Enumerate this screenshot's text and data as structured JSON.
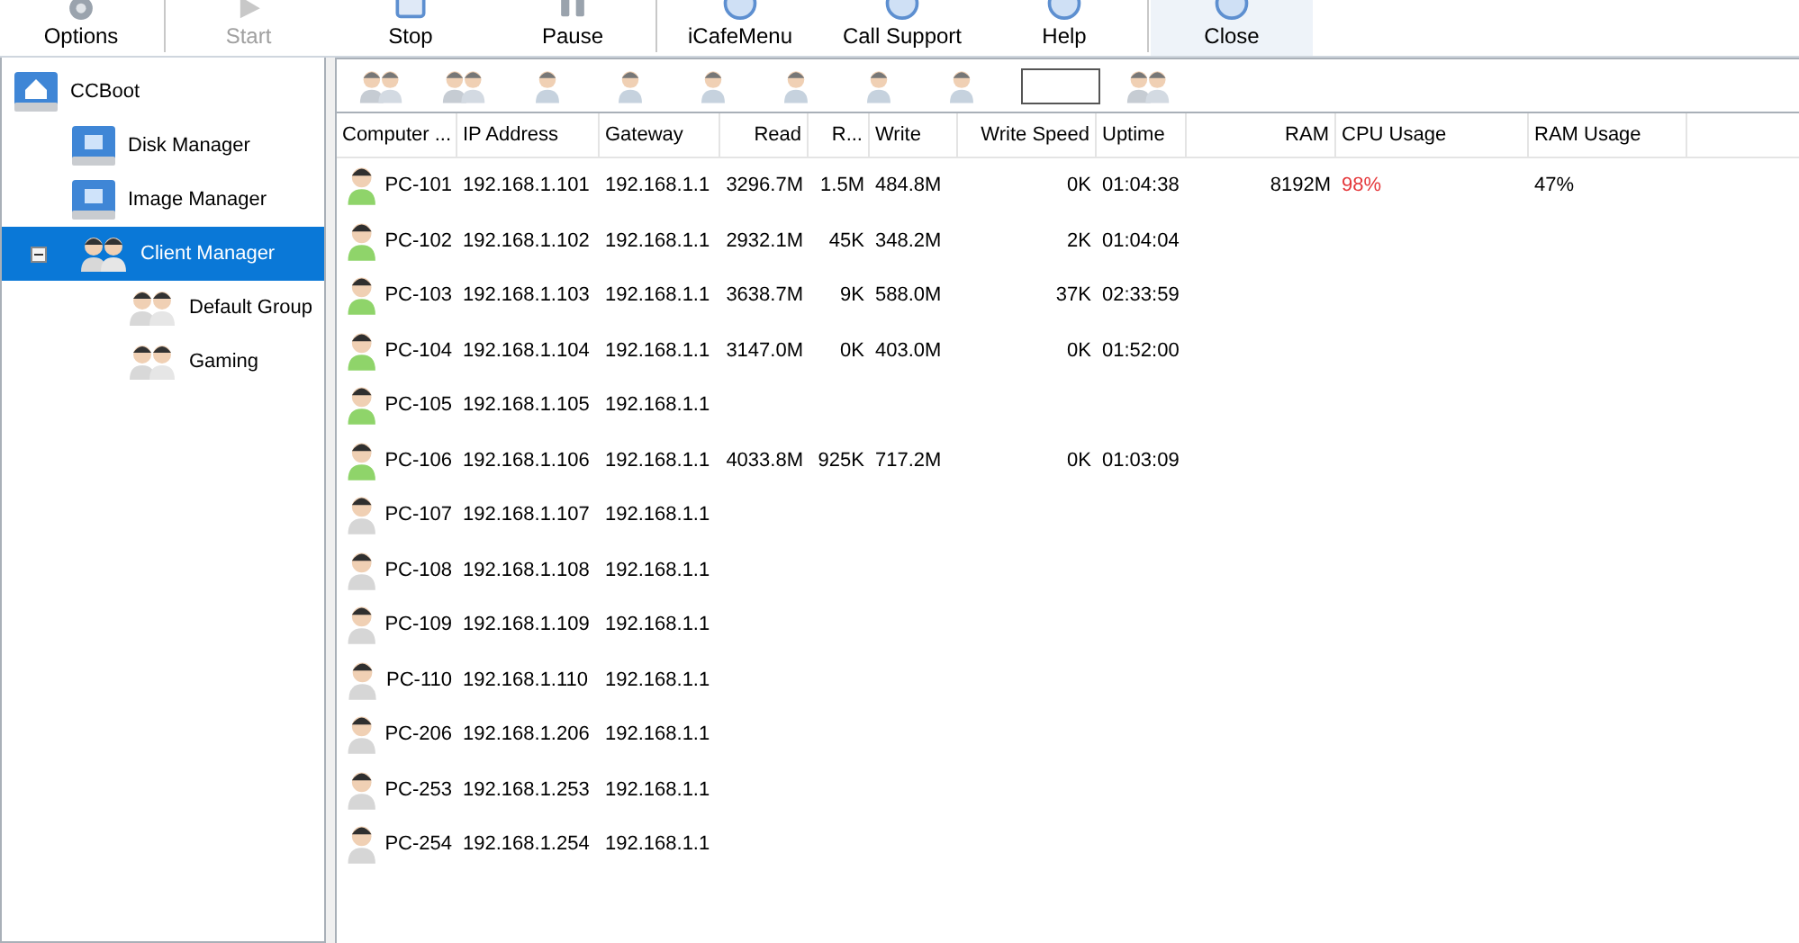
{
  "toolbar": [
    {
      "label": "Options",
      "disabled": false,
      "highlighted": false
    },
    {
      "label": "Start",
      "disabled": true,
      "highlighted": false
    },
    {
      "label": "Stop",
      "disabled": false,
      "highlighted": false
    },
    {
      "label": "Pause",
      "disabled": false,
      "highlighted": false
    },
    {
      "label": "iCafeMenu",
      "disabled": false,
      "highlighted": false
    },
    {
      "label": "Call Support",
      "disabled": false,
      "highlighted": false
    },
    {
      "label": "Help",
      "disabled": false,
      "highlighted": false
    },
    {
      "label": "Close",
      "disabled": false,
      "highlighted": true
    }
  ],
  "tree": [
    {
      "label": "CCBoot",
      "selected": false,
      "children": [
        {
          "label": "Disk Manager",
          "selected": false
        },
        {
          "label": "Image Manager",
          "selected": false
        },
        {
          "label": "Client Manager",
          "selected": true,
          "expanded": true,
          "children": [
            {
              "label": "Default Group",
              "selected": false
            },
            {
              "label": "Gaming",
              "selected": false
            }
          ]
        }
      ]
    }
  ],
  "table": {
    "columns": [
      "Computer ...",
      "IP Address",
      "Gateway",
      "Read",
      "R...",
      "Write",
      "Write Speed",
      "Uptime",
      "RAM",
      "CPU Usage",
      "RAM Usage"
    ],
    "rows": [
      {
        "online": true,
        "cells": [
          "PC-101",
          "192.168.1.101",
          "192.168.1.1",
          "3296.7M",
          "1.5M",
          "484.8M",
          "0K",
          "01:04:38",
          "8192M",
          "98%",
          "47%"
        ],
        "cpu_alert": true
      },
      {
        "online": true,
        "cells": [
          "PC-102",
          "192.168.1.102",
          "192.168.1.1",
          "2932.1M",
          "45K",
          "348.2M",
          "2K",
          "01:04:04"
        ]
      },
      {
        "online": true,
        "cells": [
          "PC-103",
          "192.168.1.103",
          "192.168.1.1",
          "3638.7M",
          "9K",
          "588.0M",
          "37K",
          "02:33:59"
        ]
      },
      {
        "online": true,
        "cells": [
          "PC-104",
          "192.168.1.104",
          "192.168.1.1",
          "3147.0M",
          "0K",
          "403.0M",
          "0K",
          "01:52:00"
        ]
      },
      {
        "online": true,
        "cells": [
          "PC-105",
          "192.168.1.105",
          "192.168.1.1"
        ]
      },
      {
        "online": true,
        "cells": [
          "PC-106",
          "192.168.1.106",
          "192.168.1.1",
          "4033.8M",
          "925K",
          "717.2M",
          "0K",
          "01:03:09"
        ]
      },
      {
        "online": false,
        "cells": [
          "PC-107",
          "192.168.1.107",
          "192.168.1.1"
        ]
      },
      {
        "online": false,
        "cells": [
          "PC-108",
          "192.168.1.108",
          "192.168.1.1"
        ]
      },
      {
        "online": false,
        "cells": [
          "PC-109",
          "192.168.1.109",
          "192.168.1.1"
        ]
      },
      {
        "online": false,
        "cells": [
          "PC-110",
          "192.168.1.110",
          "192.168.1.1"
        ]
      },
      {
        "online": false,
        "cells": [
          "PC-206",
          "192.168.1.206",
          "192.168.1.1"
        ]
      },
      {
        "online": false,
        "cells": [
          "PC-253",
          "192.168.1.253",
          "192.168.1.1"
        ]
      },
      {
        "online": false,
        "cells": [
          "PC-254",
          "192.168.1.254",
          "192.168.1.1"
        ]
      }
    ]
  }
}
